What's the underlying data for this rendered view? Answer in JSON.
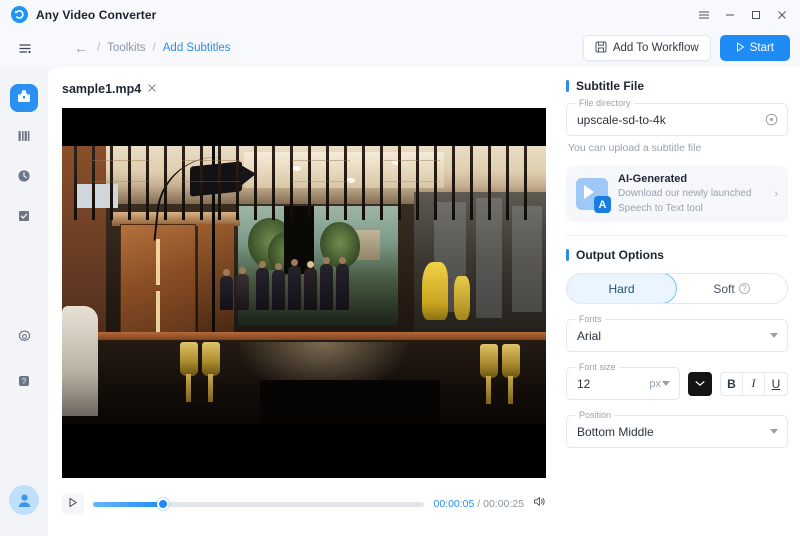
{
  "window": {
    "app_title": "Any Video Converter",
    "logo_icon": "avc-logo-icon",
    "controls": {
      "menu": "hamburger-icon",
      "minimize": "minimize-icon",
      "maximize": "maximize-icon",
      "close": "close-icon"
    }
  },
  "toolbar": {
    "sidebar_toggle_icon": "menu-list-icon",
    "back_icon": "back-arrow-icon",
    "breadcrumb": {
      "separator": "/",
      "parent": "Toolkits",
      "current": "Add Subtitles"
    },
    "add_to_workflow_label": "Add To Workflow",
    "add_to_workflow_icon": "save-disk-icon",
    "start_label": "Start",
    "start_icon": "play-triangle-icon",
    "start_color": "#1f8cf5"
  },
  "rail": {
    "items": [
      {
        "name": "converter",
        "icon": "toolbox-icon",
        "active": true
      },
      {
        "name": "media-library",
        "icon": "library-icon",
        "active": false
      },
      {
        "name": "history",
        "icon": "clock-icon",
        "active": false
      },
      {
        "name": "tasks",
        "icon": "checklist-icon",
        "active": false
      }
    ],
    "bottom_items": [
      {
        "name": "settings",
        "icon": "gear-icon"
      },
      {
        "name": "help",
        "icon": "question-icon"
      },
      {
        "name": "account",
        "icon": "user-avatar-icon"
      }
    ]
  },
  "main": {
    "file_name": "sample1.mp4",
    "close_icon": "close-icon",
    "player": {
      "play_icon": "play-triangle-icon",
      "volume_icon": "volume-icon",
      "current_time": "00:00:05",
      "separator": "/",
      "total_time": "00:00:25",
      "progress_percent": 21
    }
  },
  "right_panel": {
    "subtitle_file": {
      "heading": "Subtitle File",
      "field_label": "File directory",
      "field_value": "upscale-sd-to-4k",
      "clear_icon": "clear-circle-icon",
      "helper_text": "You can upload a subtitle file",
      "promo": {
        "title": "AI-Generated",
        "subtitle_line1": "Download our newly launched",
        "subtitle_line2": "Speech to Text tool",
        "icon": "ai-speech-to-text-icon",
        "arrow_icon": "chevron-right-icon"
      }
    },
    "output_options": {
      "heading": "Output Options",
      "mode_hard": "Hard",
      "mode_soft": "Soft",
      "soft_help_icon": "question-mark-icon",
      "selected_mode": "Hard",
      "fonts_label": "Fonts",
      "fonts_value": "Arial",
      "font_size_label": "Font size",
      "font_size_value": "12",
      "font_size_unit": "px",
      "color_value": "#141414",
      "bold_label": "B",
      "italic_label": "I",
      "underline_label": "U",
      "position_label": "Position",
      "position_value": "Bottom Middle",
      "dropdown_icon": "chevron-down-icon"
    }
  }
}
